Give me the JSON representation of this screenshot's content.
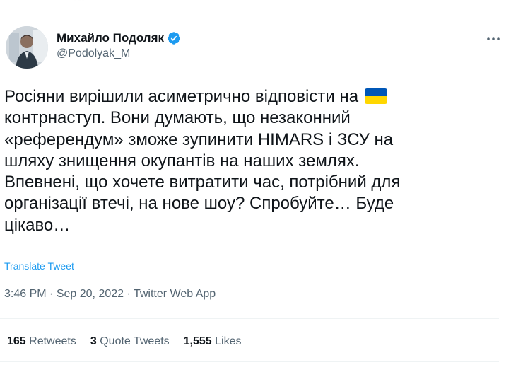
{
  "author": {
    "display_name": "Михайло Подоляк",
    "handle": "@Podolyak_M",
    "verified": true
  },
  "tweet": {
    "text": "Росіяни вирішили асиметрично відповісти на",
    "text_rest": "контрнаступ. Вони думають, що незаконний\n«референдум» зможе зупинити HIMARS і ЗСУ на\nшляху знищення окупантів на наших землях.\nВпевнені, що хочете витратити час, потрібний для\nорганізації втечі, на нове шоу? Спробуйте… Буде\nцікаво…",
    "translate_label": "Translate Tweet",
    "time": "3:46 PM",
    "date": "Sep 20, 2022",
    "app": "Twitter Web App",
    "separator": "·"
  },
  "stats": {
    "retweets_count": "165",
    "retweets_label": "Retweets",
    "quotes_count": "3",
    "quotes_label": "Quote Tweets",
    "likes_count": "1,555",
    "likes_label": "Likes"
  },
  "icons": {
    "verified": "verified-badge-icon",
    "more": "more-horizontal-icon",
    "flag": "ukraine-flag-icon"
  },
  "colors": {
    "accent": "#1d9bf0",
    "text": "#0f1419",
    "secondary": "#536471",
    "divider": "#eff3f4",
    "flag_blue": "#0057b7",
    "flag_yellow": "#ffd700"
  }
}
